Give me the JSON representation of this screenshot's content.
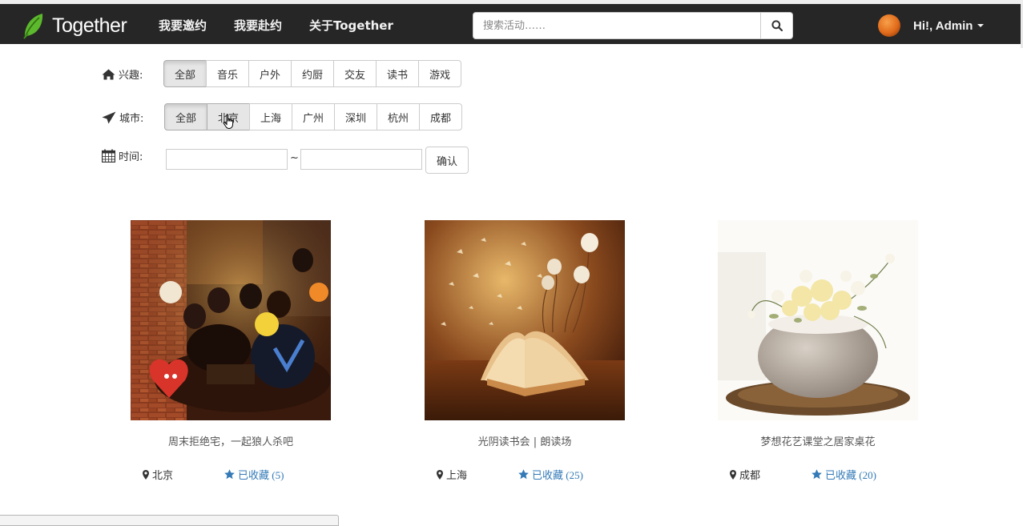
{
  "navbar": {
    "brand": "Together",
    "links": [
      "我要邀约",
      "我要赴约",
      "关于Together"
    ],
    "search": {
      "placeholder": "搜索活动……",
      "value": ""
    },
    "user": "Hi!, Admin"
  },
  "filters": {
    "interest": {
      "label": "兴趣:",
      "options": [
        "全部",
        "音乐",
        "户外",
        "约厨",
        "交友",
        "读书",
        "游戏"
      ],
      "selected": "全部"
    },
    "city": {
      "label": "城市:",
      "options": [
        "全部",
        "北京",
        "上海",
        "广州",
        "深圳",
        "杭州",
        "成都"
      ],
      "selected": "全部",
      "hovered": "北京"
    },
    "time": {
      "label": "时间:",
      "start": "",
      "separator": "~",
      "end": "",
      "confirm": "确认"
    }
  },
  "activities": [
    {
      "title": "周末拒绝宅，一起狼人杀吧",
      "city": "北京",
      "fav": "已收藏 (5)"
    },
    {
      "title": "光阴读书会 | 朗读场",
      "city": "上海",
      "fav": "已收藏 (25)"
    },
    {
      "title": "梦想花艺课堂之居家桌花",
      "city": "成都",
      "fav": "已收藏 (20)"
    }
  ],
  "colors": {
    "navbar": "#262626",
    "link": "#337ab7",
    "accent_leaf": "#5cb82c"
  },
  "icons": {
    "brand": "leaf-icon",
    "search": "search-icon",
    "interest": "home-icon",
    "city": "send-icon",
    "time": "calendar-icon",
    "location": "map-marker-icon",
    "favorite": "star-icon"
  }
}
